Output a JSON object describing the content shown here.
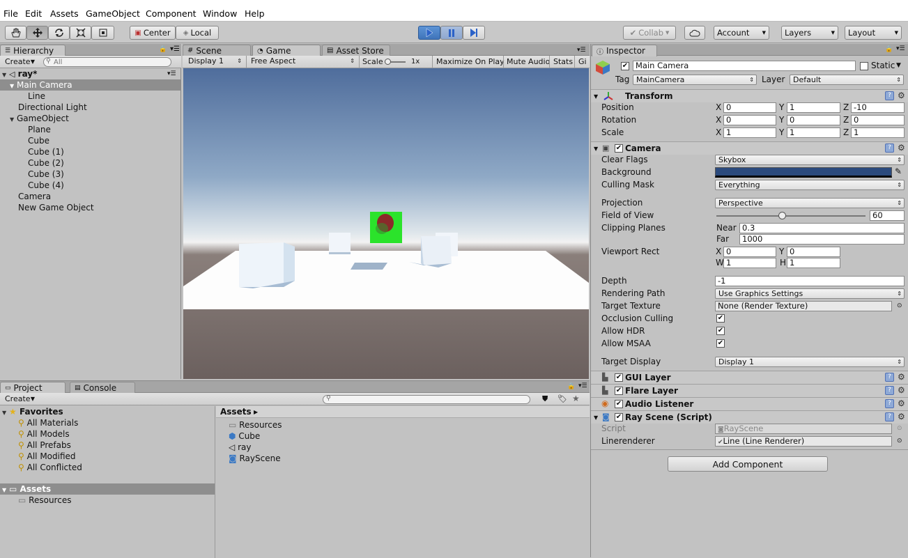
{
  "menu": [
    "File",
    "Edit",
    "Assets",
    "GameObject",
    "Component",
    "Window",
    "Help"
  ],
  "toolbar": {
    "center": "Center",
    "local": "Local",
    "collab": "Collab",
    "account": "Account",
    "layers": "Layers",
    "layout": "Layout"
  },
  "hierarchy": {
    "tab": "Hierarchy",
    "create": "Create",
    "search_placeholder": "All",
    "scene": "ray*",
    "items": [
      "Main Camera",
      "Line",
      "Directional Light",
      "GameObject",
      "Plane",
      "Cube",
      "Cube (1)",
      "Cube (2)",
      "Cube (3)",
      "Cube (4)",
      "Camera",
      "New Game Object"
    ]
  },
  "center_tabs": {
    "scene": "Scene",
    "game": "Game",
    "asset_store": "Asset Store"
  },
  "game_bar": {
    "display": "Display 1",
    "aspect": "Free Aspect",
    "scale": "Scale",
    "scale_val": "1x",
    "maximize": "Maximize On Play",
    "mute": "Mute Audio",
    "stats": "Stats",
    "gizmos": "Gi"
  },
  "project": {
    "tab": "Project",
    "console": "Console",
    "create": "Create",
    "favorites": "Favorites",
    "fav_items": [
      "All Materials",
      "All Models",
      "All Prefabs",
      "All Modified",
      "All Conflicted"
    ],
    "assets": "Assets",
    "resources": "Resources",
    "breadcrumb": "Assets",
    "files": [
      "Resources",
      "Cube",
      "ray",
      "RayScene"
    ]
  },
  "inspector": {
    "tab": "Inspector",
    "object_name": "Main Camera",
    "static": "Static",
    "tag_label": "Tag",
    "tag": "MainCamera",
    "layer_label": "Layer",
    "layer": "Default",
    "transform": {
      "title": "Transform",
      "position": "Position",
      "rotation": "Rotation",
      "scale": "Scale",
      "pos": [
        "0",
        "1",
        "-10"
      ],
      "rot": [
        "0",
        "0",
        "0"
      ],
      "scl": [
        "1",
        "1",
        "1"
      ],
      "x": "X",
      "y": "Y",
      "z": "Z"
    },
    "camera": {
      "title": "Camera",
      "clear_flags": "Clear Flags",
      "clear_flags_val": "Skybox",
      "background": "Background",
      "background_color": "#2b4a7d",
      "culling_mask": "Culling Mask",
      "culling_mask_val": "Everything",
      "projection": "Projection",
      "projection_val": "Perspective",
      "fov": "Field of View",
      "fov_val": "60",
      "fov_fraction": 0.44,
      "clipping": "Clipping Planes",
      "near": "Near",
      "near_val": "0.3",
      "far": "Far",
      "far_val": "1000",
      "viewport": "Viewport Rect",
      "vx": "0",
      "vy": "0",
      "vw": "1",
      "vh": "1",
      "w": "W",
      "h": "H",
      "depth": "Depth",
      "depth_val": "-1",
      "rendering_path": "Rendering Path",
      "rendering_path_val": "Use Graphics Settings",
      "target_texture": "Target Texture",
      "target_texture_val": "None (Render Texture)",
      "occlusion": "Occlusion Culling",
      "hdr": "Allow HDR",
      "msaa": "Allow MSAA",
      "target_display": "Target Display",
      "target_display_val": "Display 1"
    },
    "gui_layer": "GUI Layer",
    "flare_layer": "Flare Layer",
    "audio_listener": "Audio Listener",
    "ray_scene": {
      "title": "Ray Scene (Script)",
      "script": "Script",
      "script_val": "RayScene",
      "linerenderer": "Linerenderer",
      "linerenderer_val": "Line (Line Renderer)"
    },
    "add_component": "Add Component"
  }
}
